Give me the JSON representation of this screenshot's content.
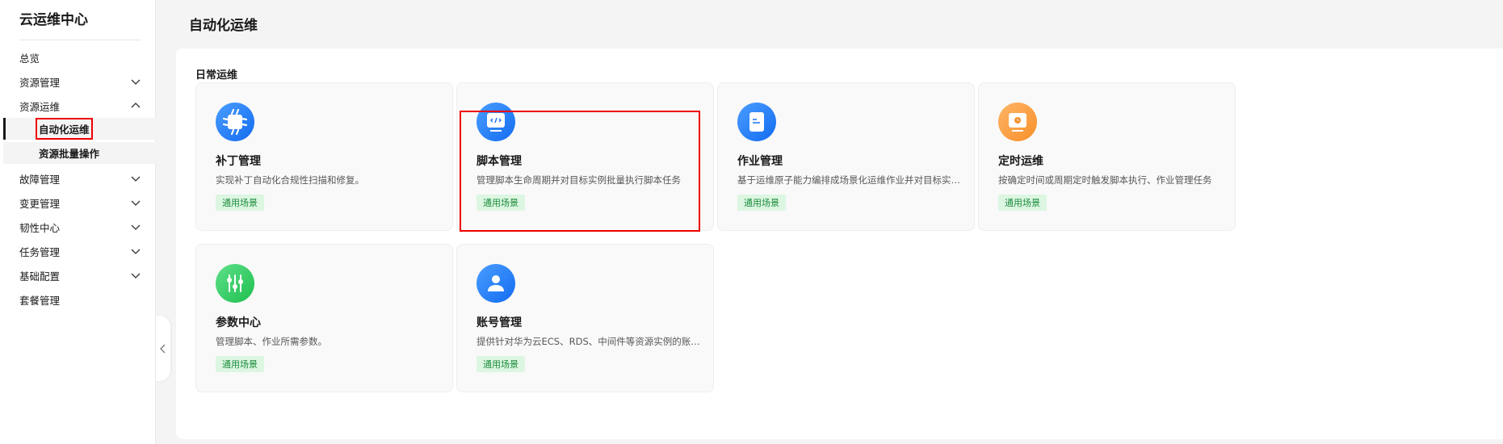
{
  "sidebar": {
    "title": "云运维中心",
    "items": [
      {
        "label": "总览",
        "chevron": ""
      },
      {
        "label": "资源管理",
        "chevron": "down"
      },
      {
        "label": "资源运维",
        "chevron": "up"
      },
      {
        "label": "自动化运维",
        "sub": true,
        "active": true
      },
      {
        "label": "资源批量操作",
        "sub": true
      },
      {
        "label": "故障管理",
        "chevron": "down"
      },
      {
        "label": "变更管理",
        "chevron": "down"
      },
      {
        "label": "韧性中心",
        "chevron": "down"
      },
      {
        "label": "任务管理",
        "chevron": "down"
      },
      {
        "label": "基础配置",
        "chevron": "down"
      },
      {
        "label": "套餐管理",
        "chevron": ""
      }
    ]
  },
  "header": {
    "title": "自动化运维"
  },
  "section": {
    "title": "日常运维"
  },
  "cards": [
    {
      "name": "补丁管理",
      "desc": "实现补丁自动化合规性扫描和修复。",
      "tag": "通用场景",
      "icon": "chip-icon",
      "color": "blue"
    },
    {
      "name": "脚本管理",
      "desc": "管理脚本生命周期并对目标实例批量执行脚本任务",
      "tag": "通用场景",
      "icon": "code-monitor-icon",
      "color": "blue"
    },
    {
      "name": "作业管理",
      "desc": "基于运维原子能力编排成场景化运维作业并对目标实例执行",
      "tag": "通用场景",
      "icon": "document-icon",
      "color": "blue"
    },
    {
      "name": "定时运维",
      "desc": "按确定时间或周期定时触发脚本执行、作业管理任务",
      "tag": "通用场景",
      "icon": "clock-monitor-icon",
      "color": "orange"
    },
    {
      "name": "参数中心",
      "desc": "管理脚本、作业所需参数。",
      "tag": "通用场景",
      "icon": "sliders-icon",
      "color": "green"
    },
    {
      "name": "账号管理",
      "desc": "提供针对华为云ECS、RDS、中间件等资源实例的账号管理",
      "tag": "通用场景",
      "icon": "user-icon",
      "color": "blue"
    }
  ]
}
